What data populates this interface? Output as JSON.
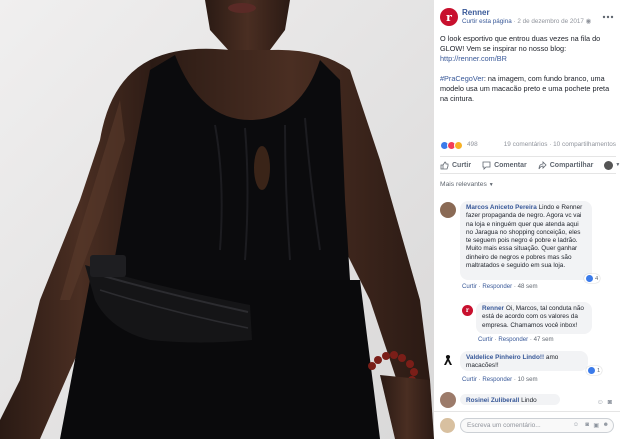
{
  "post": {
    "page_name": "Renner",
    "subtitle_action": "Curtir esta página",
    "date": "2 de dezembro de 2017",
    "paragraph1_text": "O look esportivo que entrou duas vezes na fila do GLOW! Vem se inspirar no nosso blog: ",
    "paragraph1_link": "http://renner.com/BR",
    "paragraph2_tag": "#PraCegoVer",
    "paragraph2_text": ": na imagem, com fundo branco, uma modelo usa um macacão preto e uma pochete preta na cintura."
  },
  "stats": {
    "reaction_count": "498",
    "comments_shares": "19 comentários · 10 compartilhamentos"
  },
  "actions": {
    "like": "Curtir",
    "comment": "Comentar",
    "share": "Compartilhar"
  },
  "filter": {
    "label": "Mais relevantes"
  },
  "comments": [
    {
      "name": "Marcos Aniceto Pereira",
      "text": "Lindo e Renner fazer propaganda de negro. Agora vc vai na loja e ninguém quer que atenda aqui no Jaragua no shopping conceição, eles te seguem pois negro é pobre e ladrão. Muito mais essa situação. Quer ganhar dinheiro de negros e pobres mas são maltratados e seguido em sua loja.",
      "meta_like": "Curtir",
      "meta_reply": "Responder",
      "meta_time": "48 sem",
      "reactions": "4"
    },
    {
      "name": "Renner",
      "text": "Oi, Marcos, tal conduta não está de acordo com os valores da empresa. Chamamos você inbox!",
      "meta_like": "Curtir",
      "meta_reply": "Responder",
      "meta_time": "47 sem"
    },
    {
      "name": "Valdelice Pinheiro Lindo!!",
      "text": "amo macacões!!",
      "meta_like": "Curtir",
      "meta_reply": "Responder",
      "meta_time": "10 sem",
      "reactions": "1"
    },
    {
      "name": "Rosinei Zuliberall",
      "text": "Lindo"
    }
  ],
  "composer": {
    "placeholder": "Escreva um comentário..."
  },
  "colors": {
    "brand": "#c8102e",
    "link": "#385898",
    "like_blue": "#3b7bea"
  }
}
